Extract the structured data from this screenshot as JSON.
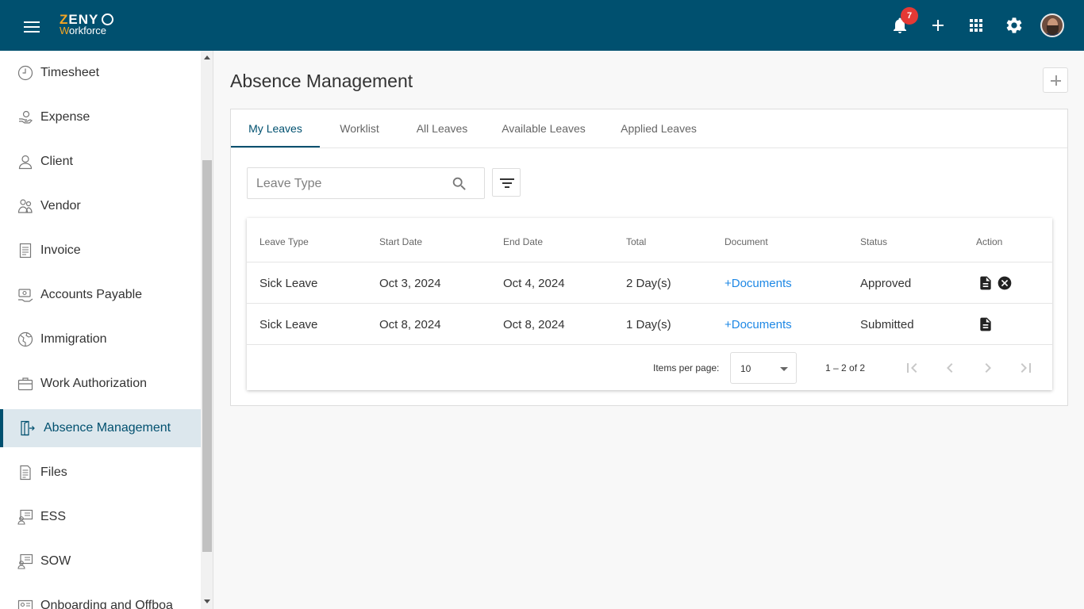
{
  "colors": {
    "topbar": "#00506f",
    "accent": "#00506f",
    "link": "#1e88e5",
    "badge": "#e53935",
    "logo_accent": "#f5a623"
  },
  "header": {
    "logo_top": "ZENY",
    "logo_bottom": "Workforce",
    "notification_count": "7",
    "icons": [
      "menu-icon",
      "bell-icon",
      "plus-icon",
      "apps-grid-icon",
      "gear-icon",
      "avatar"
    ]
  },
  "sidebar": {
    "items": [
      {
        "label": "Timesheet",
        "icon": "clock-icon"
      },
      {
        "label": "Expense",
        "icon": "expense-icon"
      },
      {
        "label": "Client",
        "icon": "person-icon"
      },
      {
        "label": "Vendor",
        "icon": "vendor-icon"
      },
      {
        "label": "Invoice",
        "icon": "invoice-icon"
      },
      {
        "label": "Accounts Payable",
        "icon": "accounts-payable-icon"
      },
      {
        "label": "Immigration",
        "icon": "globe-icon"
      },
      {
        "label": "Work Authorization",
        "icon": "briefcase-icon"
      },
      {
        "label": "Absence Management",
        "icon": "door-exit-icon",
        "active": true
      },
      {
        "label": "Files",
        "icon": "file-icon"
      },
      {
        "label": "ESS",
        "icon": "monitor-user-icon"
      },
      {
        "label": "SOW",
        "icon": "monitor-user-icon"
      },
      {
        "label": "Onboarding and Offboa",
        "icon": "id-card-icon"
      }
    ]
  },
  "main": {
    "title": "Absence Management",
    "tabs": [
      {
        "label": "My Leaves",
        "active": true
      },
      {
        "label": "Worklist"
      },
      {
        "label": "All Leaves"
      },
      {
        "label": "Available Leaves"
      },
      {
        "label": "Applied Leaves"
      }
    ],
    "search": {
      "placeholder": "Leave Type",
      "value": ""
    },
    "table": {
      "columns": [
        "Leave Type",
        "Start Date",
        "End Date",
        "Total",
        "Document",
        "Status",
        "Action"
      ],
      "rows": [
        {
          "leave_type": "Sick Leave",
          "start": "Oct 3, 2024",
          "end": "Oct 4, 2024",
          "total": "2 Day(s)",
          "document": "+Documents",
          "status": "Approved",
          "actions": [
            "document-icon",
            "cancel-icon"
          ]
        },
        {
          "leave_type": "Sick Leave",
          "start": "Oct 8, 2024",
          "end": "Oct 8, 2024",
          "total": "1 Day(s)",
          "document": "+Documents",
          "status": "Submitted",
          "actions": [
            "document-icon"
          ]
        }
      ]
    },
    "paginator": {
      "items_per_page_label": "Items per page:",
      "items_per_page": "10",
      "range": "1 – 2 of 2"
    }
  }
}
